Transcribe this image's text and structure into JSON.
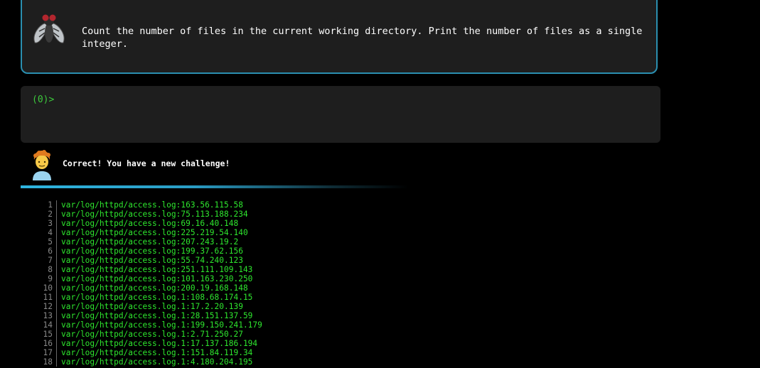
{
  "challenge": {
    "icon": "fly-icon",
    "text": "Count the number of files in the current working directory. Print the number of files as a single integer."
  },
  "terminal": {
    "prompt": "(0)>",
    "input_value": ""
  },
  "feedback": {
    "avatar_icon": "person-avatar-icon",
    "message": "Correct! You have a new challenge!"
  },
  "colors": {
    "accent": "#2a8fb0",
    "output_green": "#2ee62e",
    "prompt_green": "#3cc93c"
  },
  "output": {
    "lines": [
      {
        "n": "1",
        "text": "var/log/httpd/access.log:163.56.115.58"
      },
      {
        "n": "2",
        "text": "var/log/httpd/access.log:75.113.188.234"
      },
      {
        "n": "3",
        "text": "var/log/httpd/access.log:69.16.40.148"
      },
      {
        "n": "4",
        "text": "var/log/httpd/access.log:225.219.54.140"
      },
      {
        "n": "5",
        "text": "var/log/httpd/access.log:207.243.19.2"
      },
      {
        "n": "6",
        "text": "var/log/httpd/access.log:199.37.62.156"
      },
      {
        "n": "7",
        "text": "var/log/httpd/access.log:55.74.240.123"
      },
      {
        "n": "8",
        "text": "var/log/httpd/access.log:251.111.109.143"
      },
      {
        "n": "9",
        "text": "var/log/httpd/access.log:101.163.230.250"
      },
      {
        "n": "10",
        "text": "var/log/httpd/access.log:200.19.168.148"
      },
      {
        "n": "11",
        "text": "var/log/httpd/access.log.1:108.68.174.15"
      },
      {
        "n": "12",
        "text": "var/log/httpd/access.log.1:17.2.20.139"
      },
      {
        "n": "13",
        "text": "var/log/httpd/access.log.1:28.151.137.59"
      },
      {
        "n": "14",
        "text": "var/log/httpd/access.log.1:199.150.241.179"
      },
      {
        "n": "15",
        "text": "var/log/httpd/access.log.1:2.71.250.27"
      },
      {
        "n": "16",
        "text": "var/log/httpd/access.log.1:17.137.186.194"
      },
      {
        "n": "17",
        "text": "var/log/httpd/access.log.1:151.84.119.34"
      },
      {
        "n": "18",
        "text": "var/log/httpd/access.log.1:4.180.204.195"
      }
    ]
  }
}
